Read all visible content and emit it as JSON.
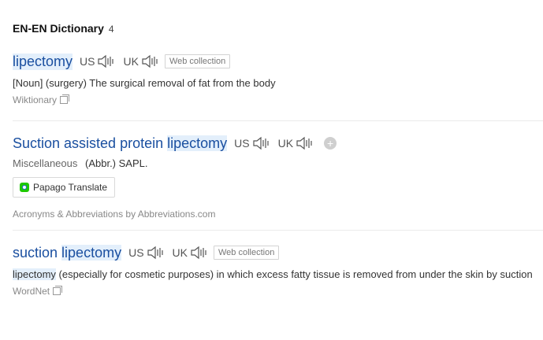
{
  "header": {
    "title": "EN-EN Dictionary",
    "count": "4"
  },
  "entries": [
    {
      "headword": "lipectomy",
      "us_label": "US",
      "uk_label": "UK",
      "tag": "Web collection",
      "definition": "[Noun] (surgery) The surgical removal of fat from the body",
      "source": "Wiktionary"
    },
    {
      "headword_prefix": "Suction assisted protein ",
      "headword_hl": "lipectomy",
      "us_label": "US",
      "uk_label": "UK",
      "category": "Miscellaneous",
      "definition": "(Abbr.) SAPL.",
      "papago_label": "Papago Translate",
      "source": "Acronyms & Abbreviations by Abbreviations.com"
    },
    {
      "headword_prefix": "suction ",
      "headword_hl": "lipectomy",
      "us_label": "US",
      "uk_label": "UK",
      "tag": "Web collection",
      "definition_kw": "lipectomy",
      "definition_rest": " (especially for cosmetic purposes) in which excess fatty tissue is removed from under the skin by suction",
      "source": "WordNet"
    }
  ],
  "icons": {
    "speaker": "speaker-icon",
    "add": "plus-circle-icon",
    "copy": "copy-icon",
    "papago": "papago-logo-icon"
  },
  "colors": {
    "headword": "#1a4fa0",
    "highlight": "#e3effb",
    "papago_green": "#1ec800"
  }
}
